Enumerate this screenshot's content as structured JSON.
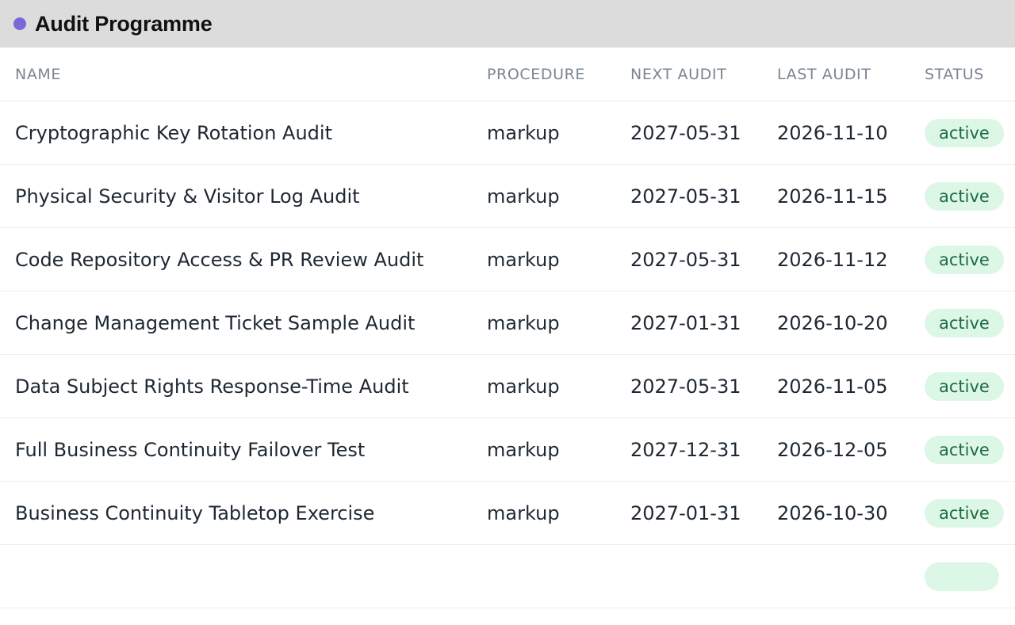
{
  "window": {
    "title": "Audit Programme",
    "accent_color": "#7b68d8"
  },
  "table": {
    "columns": {
      "name": "NAME",
      "procedure": "PROCEDURE",
      "next_audit": "NEXT AUDIT",
      "last_audit": "LAST AUDIT",
      "status": "STATUS"
    },
    "rows": [
      {
        "name": "Cryptographic Key Rotation Audit",
        "procedure": "markup",
        "next_audit": "2027-05-31",
        "last_audit": "2026-11-10",
        "status": "active"
      },
      {
        "name": "Physical Security & Visitor Log Audit",
        "procedure": "markup",
        "next_audit": "2027-05-31",
        "last_audit": "2026-11-15",
        "status": "active"
      },
      {
        "name": "Code Repository Access & PR Review Audit",
        "procedure": "markup",
        "next_audit": "2027-05-31",
        "last_audit": "2026-11-12",
        "status": "active"
      },
      {
        "name": "Change Management Ticket Sample Audit",
        "procedure": "markup",
        "next_audit": "2027-01-31",
        "last_audit": "2026-10-20",
        "status": "active"
      },
      {
        "name": "Data Subject Rights Response-Time Audit",
        "procedure": "markup",
        "next_audit": "2027-05-31",
        "last_audit": "2026-11-05",
        "status": "active"
      },
      {
        "name": "Full Business Continuity Failover Test",
        "procedure": "markup",
        "next_audit": "2027-12-31",
        "last_audit": "2026-12-05",
        "status": "active"
      },
      {
        "name": "Business Continuity Tabletop Exercise",
        "procedure": "markup",
        "next_audit": "2027-01-31",
        "last_audit": "2026-10-30",
        "status": "active"
      }
    ],
    "status_colors": {
      "active_bg": "#dcf7e6",
      "active_text": "#1d6b3f"
    }
  }
}
